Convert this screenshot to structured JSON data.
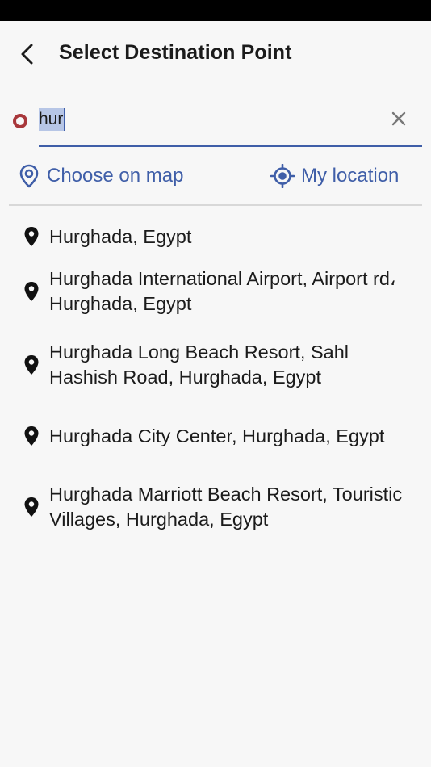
{
  "header": {
    "title": "Select Destination Point"
  },
  "search": {
    "value": "hur",
    "placeholder": ""
  },
  "options": {
    "choose_on_map": "Choose on map",
    "my_location": "My location"
  },
  "colors": {
    "accent": "#3f5ea8",
    "origin_dot": "#a8373b",
    "text": "#1b1b1b",
    "background": "#f7f7f7"
  },
  "results": [
    {
      "label": "Hurghada, Egypt"
    },
    {
      "label": "Hurghada International Airport, Airport rd، Hurghada, Egypt"
    },
    {
      "label": "Hurghada Long Beach Resort, Sahl Hashish Road, Hurghada, Egypt"
    },
    {
      "label": "Hurghada City Center, Hurghada, Egypt"
    },
    {
      "label": "Hurghada Marriott Beach Resort, Touristic Villages, Hurghada, Egypt"
    }
  ]
}
